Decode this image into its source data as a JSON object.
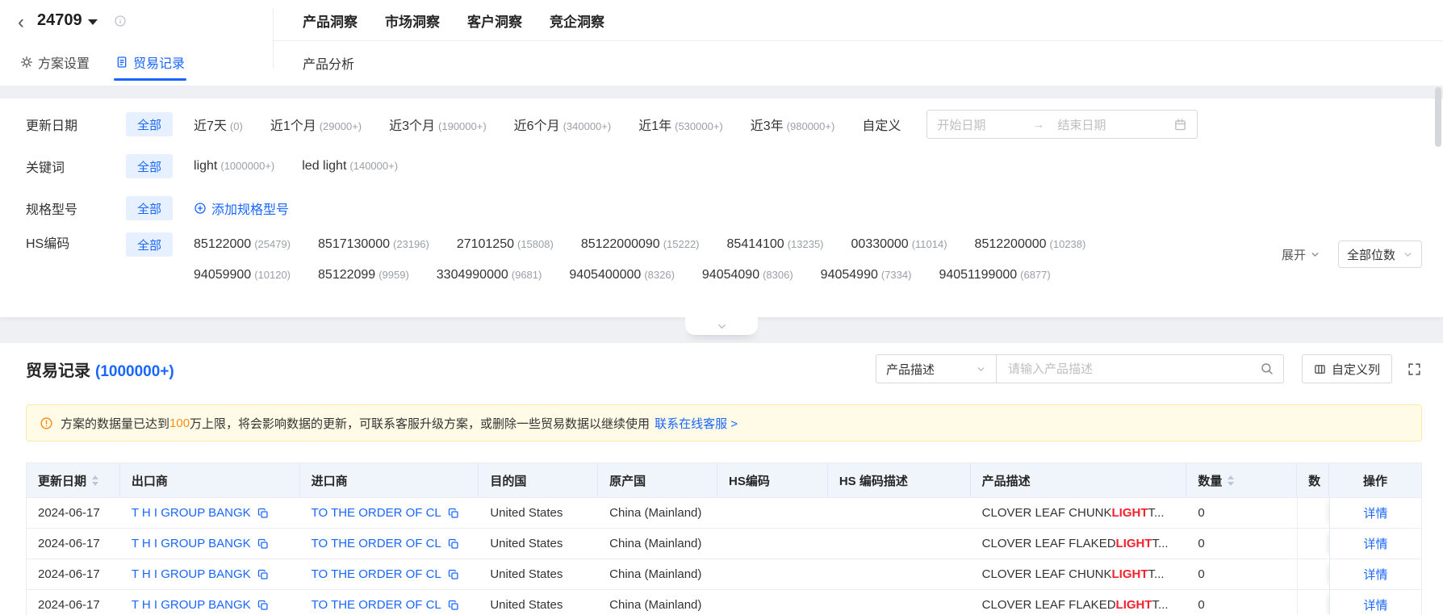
{
  "colors": {
    "accent": "#1966ff",
    "warning": "#fa8c16",
    "highlight_red": "#f5222d"
  },
  "header": {
    "back_icon": "‹",
    "plan_id": "24709",
    "nav_tabs": [
      "产品洞察",
      "市场洞察",
      "客户洞察",
      "竞企洞察"
    ],
    "sub_tab": "产品分析",
    "settings_tab": "方案设置",
    "records_tab": "贸易记录"
  },
  "filters": {
    "update_date": {
      "label": "更新日期",
      "all": "全部",
      "options": [
        {
          "label": "近7天",
          "count": "(0)"
        },
        {
          "label": "近1个月",
          "count": "(29000+)"
        },
        {
          "label": "近3个月",
          "count": "(190000+)"
        },
        {
          "label": "近6个月",
          "count": "(340000+)"
        },
        {
          "label": "近1年",
          "count": "(530000+)"
        },
        {
          "label": "近3年",
          "count": "(980000+)"
        },
        {
          "label": "自定义",
          "count": ""
        }
      ],
      "start_placeholder": "开始日期",
      "range_arrow": "→",
      "end_placeholder": "结束日期"
    },
    "keyword": {
      "label": "关键词",
      "all": "全部",
      "options": [
        {
          "label": "light",
          "count": "(1000000+)"
        },
        {
          "label": "led light",
          "count": "(140000+)"
        }
      ]
    },
    "spec": {
      "label": "规格型号",
      "all": "全部",
      "add_label": "添加规格型号"
    },
    "hs_code": {
      "label": "HS编码",
      "all": "全部",
      "line1": [
        {
          "label": "85122000",
          "count": "(25479)"
        },
        {
          "label": "8517130000",
          "count": "(23196)"
        },
        {
          "label": "27101250",
          "count": "(15808)"
        },
        {
          "label": "85122000090",
          "count": "(15222)"
        },
        {
          "label": "85414100",
          "count": "(13235)"
        },
        {
          "label": "00330000",
          "count": "(11014)"
        },
        {
          "label": "8512200000",
          "count": "(10238)"
        }
      ],
      "line2": [
        {
          "label": "94059900",
          "count": "(10120)"
        },
        {
          "label": "85122099",
          "count": "(9959)"
        },
        {
          "label": "3304990000",
          "count": "(9681)"
        },
        {
          "label": "9405400000",
          "count": "(8326)"
        },
        {
          "label": "94054090",
          "count": "(8306)"
        },
        {
          "label": "94054990",
          "count": "(7334)"
        },
        {
          "label": "94051199000",
          "count": "(6877)"
        }
      ],
      "expand_label": "展开",
      "digits_label": "全部位数"
    }
  },
  "records": {
    "title": "贸易记录",
    "count": "(1000000+)",
    "search_select": "产品描述",
    "search_placeholder": "请输入产品描述",
    "custom_columns_label": "自定义列",
    "banner": {
      "pre": "方案的数据量已达到",
      "highlight": "100",
      "post": "万上限，将会影响数据的更新，可联系客服升级方案，或删除一些贸易数据以继续使用",
      "link": "联系在线客服 >"
    },
    "table": {
      "columns": [
        "更新日期",
        "出口商",
        "进口商",
        "目的国",
        "原产国",
        "HS编码",
        "HS 编码描述",
        "产品描述",
        "数量",
        "数",
        "操作"
      ],
      "rows": [
        {
          "date": "2024-06-17",
          "exporter": "T H I GROUP BANGK",
          "importer": "TO THE ORDER OF CL",
          "destination": "United States",
          "origin": "China (Mainland)",
          "hs_code": "",
          "hs_desc": "",
          "product_pre": "CLOVER LEAF CHUNK ",
          "product_hl": "LIGHT",
          "product_post": " T...",
          "qty": "0",
          "unit": "",
          "action": "详情"
        },
        {
          "date": "2024-06-17",
          "exporter": "T H I GROUP BANGK",
          "importer": "TO THE ORDER OF CL",
          "destination": "United States",
          "origin": "China (Mainland)",
          "hs_code": "",
          "hs_desc": "",
          "product_pre": "CLOVER LEAF FLAKED ",
          "product_hl": "LIGHT",
          "product_post": " T...",
          "qty": "0",
          "unit": "",
          "action": "详情"
        },
        {
          "date": "2024-06-17",
          "exporter": "T H I GROUP BANGK",
          "importer": "TO THE ORDER OF CL",
          "destination": "United States",
          "origin": "China (Mainland)",
          "hs_code": "",
          "hs_desc": "",
          "product_pre": "CLOVER LEAF CHUNK ",
          "product_hl": "LIGHT",
          "product_post": " T...",
          "qty": "0",
          "unit": "",
          "action": "详情"
        },
        {
          "date": "2024-06-17",
          "exporter": "T H I GROUP BANGK",
          "importer": "TO THE ORDER OF CL",
          "destination": "United States",
          "origin": "China (Mainland)",
          "hs_code": "",
          "hs_desc": "",
          "product_pre": "CLOVER LEAF FLAKED ",
          "product_hl": "LIGHT",
          "product_post": " T...",
          "qty": "0",
          "unit": "",
          "action": "详情"
        }
      ]
    }
  }
}
